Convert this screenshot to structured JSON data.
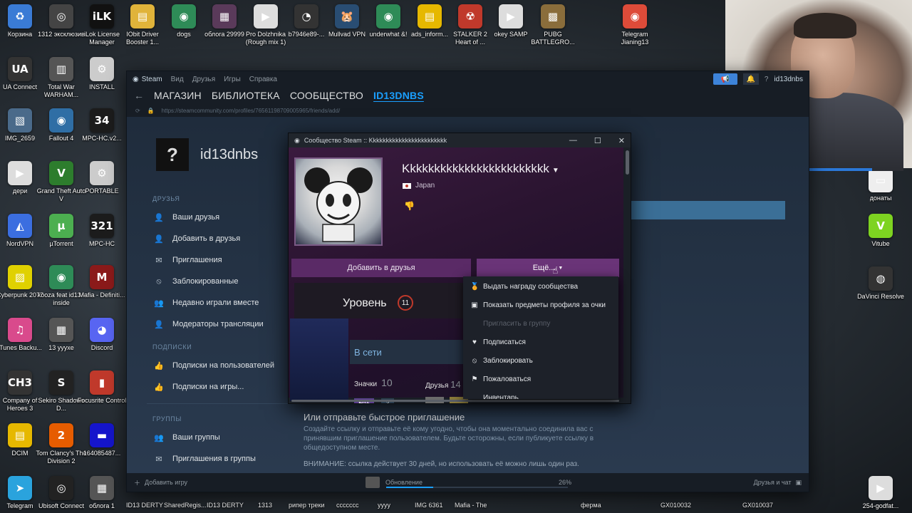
{
  "desktop": {
    "left_icons": [
      {
        "label": "Корзина",
        "glyph": "♻",
        "color": "#3a7bd5"
      },
      {
        "label": "1312 эксклюзив",
        "glyph": "◎",
        "color": "#444"
      },
      {
        "label": "iLok License Manager",
        "glyph": "iLK",
        "color": "#111"
      },
      {
        "label": "IObit Driver Booster 1...",
        "glyph": "▤",
        "color": "#e0b33a"
      },
      {
        "label": "dogs",
        "glyph": "◉",
        "color": "#2e8b57"
      },
      {
        "label": "облога 29999",
        "glyph": "▦",
        "color": "#5a3a5a"
      },
      {
        "label": "Pro Dolzhnika (Rough mix 1)",
        "glyph": "▶",
        "color": "#ddd"
      },
      {
        "label": "b7946e89-...",
        "glyph": "◔",
        "color": "#333"
      },
      {
        "label": "Mullvad VPN",
        "glyph": "🐹",
        "color": "#294d73"
      },
      {
        "label": "underwhat &!",
        "glyph": "◉",
        "color": "#2e8b57"
      },
      {
        "label": "ads_inform...",
        "glyph": "▤",
        "color": "#e6b800"
      },
      {
        "label": "STALKER 2 Heart of ...",
        "glyph": "☢",
        "color": "#c0392b"
      },
      {
        "label": "okey SAMP",
        "glyph": "▶",
        "color": "#ddd"
      },
      {
        "label": "PUBG BATTLEGRO...",
        "glyph": "▩",
        "color": "#8a6d3b"
      },
      {
        "label": "Telegram Jianing13",
        "glyph": "◉",
        "color": "#dd4b39"
      },
      {
        "label": "UA Connect",
        "glyph": "UA",
        "color": "#333"
      },
      {
        "label": "Total War WARHAM...",
        "glyph": "▥",
        "color": "#555"
      },
      {
        "label": "INSTALL",
        "glyph": "⚙",
        "color": "#ccc"
      },
      {
        "label": "IMG_2659",
        "glyph": "▧",
        "color": "#4a6a8a"
      },
      {
        "label": "Fallout 4",
        "glyph": "◉",
        "color": "#2f6ea5"
      },
      {
        "label": "MPC-HC.v2...",
        "glyph": "34",
        "color": "#1c1c1c"
      },
      {
        "label": "дери",
        "glyph": "▶",
        "color": "#ddd"
      },
      {
        "label": "Grand Theft Auto V",
        "glyph": "V",
        "color": "#2d7d2d"
      },
      {
        "label": "PORTABLE",
        "glyph": "⚙",
        "color": "#ccc"
      },
      {
        "label": "NordVPN",
        "glyph": "◭",
        "color": "#3b6ee0"
      },
      {
        "label": "µTorrent",
        "glyph": "µ",
        "color": "#4caf50"
      },
      {
        "label": "MPC-HC",
        "glyph": "321",
        "color": "#1c1c1c"
      },
      {
        "label": "Cyberpunk 2077",
        "glyph": "▨",
        "color": "#e0d100"
      },
      {
        "label": "koоza feat id13 - inside",
        "glyph": "◉",
        "color": "#2e8b57"
      },
      {
        "label": "Mafia - Definiti...",
        "glyph": "M",
        "color": "#8b1a1a"
      },
      {
        "label": "iTunes Backu...",
        "glyph": "♫",
        "color": "#d94a8c"
      },
      {
        "label": "13 yyyxe",
        "glyph": "▦",
        "color": "#555"
      },
      {
        "label": "Discord",
        "glyph": "◕",
        "color": "#5865f2"
      },
      {
        "label": "Company of Heroes 3",
        "glyph": "CH3",
        "color": "#333"
      },
      {
        "label": "Sekiro Shadows D...",
        "glyph": "S",
        "color": "#222"
      },
      {
        "label": "Focusrite Control",
        "glyph": "▮",
        "color": "#c0392b"
      },
      {
        "label": "DCIM",
        "glyph": "▤",
        "color": "#e6b800"
      },
      {
        "label": "Tom Clancy's The Division 2",
        "glyph": "2",
        "color": "#e65c00"
      },
      {
        "label": "164085487...",
        "glyph": "▬",
        "color": "#1515cc"
      },
      {
        "label": "Telegram",
        "glyph": "➤",
        "color": "#2aa3dd"
      },
      {
        "label": "Ubisoft Connect",
        "glyph": "◎",
        "color": "#222"
      },
      {
        "label": "облога 1",
        "glyph": "▦",
        "color": "#555"
      }
    ],
    "right_icons": [
      {
        "label": "донаты",
        "glyph": "▭",
        "color": "#eee"
      },
      {
        "label": "Vitube",
        "glyph": "V",
        "color": "#7ed321"
      },
      {
        "label": "DaVinci Resolve",
        "glyph": "◍",
        "color": "#333"
      },
      {
        "label": "254-godfat...",
        "glyph": "▶",
        "color": "#ddd"
      }
    ],
    "bottom_strip": [
      "ID13 DERTY",
      "SharedRegis...",
      "ID13 DERTY",
      "1313",
      "рипер треки",
      "ccccccc",
      "уууу",
      "IMG 6361",
      "Mafia - The",
      "ферма",
      "GX010032",
      "GX010037"
    ]
  },
  "steam": {
    "menu": [
      "Steam",
      "Вид",
      "Друзья",
      "Игры",
      "Справка"
    ],
    "user": "id13dnbs",
    "nav": [
      "МАГАЗИН",
      "БИБЛИОТЕКА",
      "СООБЩЕСТВО",
      "ID13DNBS"
    ],
    "url": "https://steamcommunity.com/profiles/76561198709005965/friends/add/",
    "profile_name": "id13dnbs",
    "sidebar": {
      "friends_section": "ДРУЗЬЯ",
      "friends_items": [
        {
          "label": "Ваши друзья",
          "icon": "user-icon"
        },
        {
          "label": "Добавить в друзья",
          "icon": "user-plus-icon"
        },
        {
          "label": "Приглашения",
          "icon": "envelope-icon"
        },
        {
          "label": "Заблокированные",
          "icon": "block-icon"
        },
        {
          "label": "Недавно играли вместе",
          "icon": "users-icon"
        },
        {
          "label": "Модераторы трансляции",
          "icon": "user-icon"
        }
      ],
      "subs_section": "ПОДПИСКИ",
      "subs_items": [
        {
          "label": "Подписки на пользователей",
          "icon": "thumb-icon"
        },
        {
          "label": "Подписки на игры...",
          "icon": "thumb-icon"
        }
      ],
      "groups_section": "ГРУППЫ",
      "groups_items": [
        {
          "label": "Ваши группы",
          "icon": "group-icon"
        },
        {
          "label": "Приглашения в группы",
          "icon": "envelope-icon"
        }
      ]
    },
    "invite_title": "Или отправьте быстрое приглашение",
    "invite_text": "Создайте ссылку и отправьте её кому угодно, чтобы она моментально соединила вас с принявшим приглашение пользователем. Будьте осторожны, если публикуете ссылку в общедоступном месте.",
    "invite_warning": "ВНИМАНИЕ: ссылка действует 30 дней, но использовать её можно лишь один раз.",
    "status": {
      "add_game": "Добавить игру",
      "update": "Обновление",
      "percent": "26%",
      "progress": 0.26,
      "friends_chat": "Друзья и чат"
    }
  },
  "popup": {
    "title": "Сообщество Steam :: Kkkkkkkkkkkkkkkkkkkkkkkk",
    "name": "Kkkkkkkkkkkkkkkkkkkkkkkk",
    "country": "Japan",
    "add_friend": "Добавить в друзья",
    "more": "Ещё...",
    "level_label": "Уровень",
    "level": "11",
    "online": "В сети",
    "badges_label": "Значки",
    "badges_count": "10",
    "friends_label": "Друзья",
    "friends_count": "14",
    "badge_xp": "50+",
    "badge_small": "3"
  },
  "dropdown": [
    {
      "label": "Выдать награду сообщества",
      "icon": "award-icon",
      "disabled": false
    },
    {
      "label": "Показать предметы профиля за очки",
      "icon": "profile-icon",
      "disabled": false
    },
    {
      "label": "Пригласить в группу",
      "icon": "",
      "disabled": true
    },
    {
      "label": "Подписаться",
      "icon": "heart-icon",
      "disabled": false
    },
    {
      "label": "Заблокировать",
      "icon": "block-icon",
      "disabled": false
    },
    {
      "label": "Пожаловаться",
      "icon": "flag-icon",
      "disabled": false
    },
    {
      "label": "Инвентарь",
      "icon": "",
      "disabled": false
    }
  ]
}
